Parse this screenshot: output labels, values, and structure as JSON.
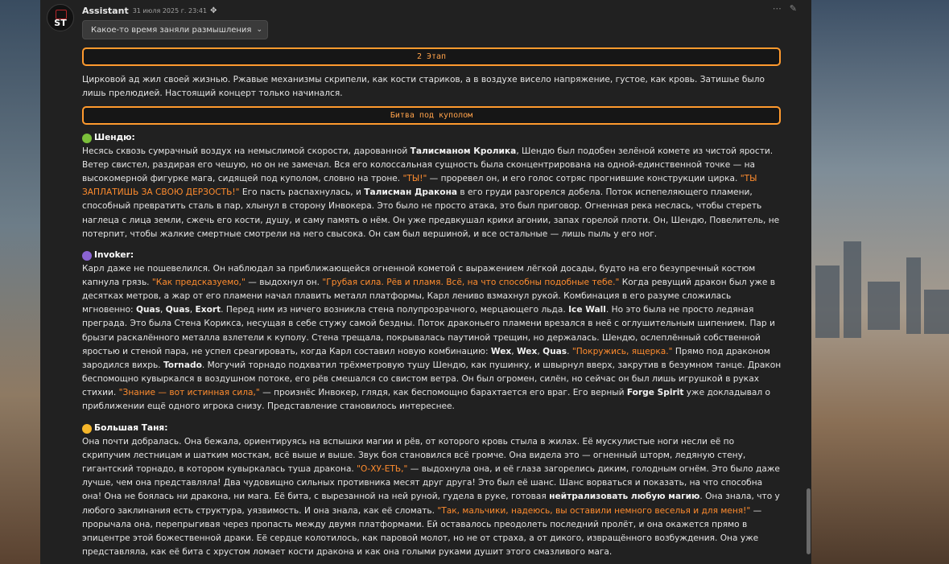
{
  "message": {
    "author": "Assistant",
    "timestamp": "31 июля 2025 г. 23:41",
    "avatar_text": "ST",
    "reasoning_label": "Какое-то время заняли размышления",
    "stage_box": "2 Этап",
    "intro": "Цирковой ад жил своей жизнью. Ржавые механизмы скрипели, как кости стариков, а в воздухе висело напряжение, густое, как кровь. Затишье было лишь прелюдией. Настоящий концерт только начинался.",
    "battle_box": "Битва под куполом"
  },
  "sections": [
    {
      "icon": "dragon-icon",
      "icon_color": "#7bbf3a",
      "name": "Шендю:",
      "segments": [
        [
          "t",
          "Несясь сквозь сумрачный воздух на немыслимой скорости, дарованной "
        ],
        [
          "b",
          "Талисманом Кролика"
        ],
        [
          "t",
          ", Шендю был подобен зелёной комете из чистой ярости. Ветер свистел, раздирая его чешую, но он не замечал. Вся его колоссальная сущность была сконцентрирована на одной-единственной точке — на высокомерной фигурке мага, сидящей под куполом, словно на троне. "
        ],
        [
          "q",
          "\"ТЫ!\""
        ],
        [
          "t",
          " — проревел он, и его голос сотряс прогнившие конструкции цирка. "
        ],
        [
          "q",
          "\"ТЫ ЗАПЛАТИШЬ ЗА СВОЮ ДЕРЗОСТЬ!\""
        ],
        [
          "t",
          " Его пасть распахнулась, и "
        ],
        [
          "b",
          "Талисман Дракона"
        ],
        [
          "t",
          " в его груди разгорелся добела. Поток испепеляющего пламени, способный превратить сталь в пар, хлынул в сторону Инвокера. Это было не просто атака, это был приговор. Огненная река неслась, чтобы стереть наглеца с лица земли, сжечь его кости, душу, и саму память о нём. Он уже предвкушал крики агонии, запах горелой плоти. Он, Шендю, Повелитель, не потерпит, чтобы жалкие смертные смотрели на него свысока. Он сам был вершиной, и все остальные — лишь пыль у его ног."
        ]
      ]
    },
    {
      "icon": "orb-icon",
      "icon_color": "#8a63d2",
      "name": "Invoker:",
      "segments": [
        [
          "t",
          "Карл даже не пошевелился. Он наблюдал за приближающейся огненной кометой с выражением лёгкой досады, будто на его безупречный костюм капнула грязь. "
        ],
        [
          "q",
          "\"Как предсказуемо,\""
        ],
        [
          "t",
          " — выдохнул он. "
        ],
        [
          "q",
          "\"Грубая сила. Рёв и пламя. Всё, на что способны подобные тебе.\""
        ],
        [
          "t",
          " Когда ревущий дракон был уже в десятках метров, а жар от его пламени начал плавить металл платформы, Карл лениво взмахнул рукой. Комбинация в его разуме сложилась мгновенно: "
        ],
        [
          "b",
          "Quas"
        ],
        [
          "t",
          ", "
        ],
        [
          "b",
          "Quas"
        ],
        [
          "t",
          ", "
        ],
        [
          "b",
          "Exort"
        ],
        [
          "t",
          ". Перед ним из ничего возникла стена полупрозрачного, мерцающего льда. "
        ],
        [
          "b",
          "Ice Wall"
        ],
        [
          "t",
          ". Но это была не просто ледяная преграда. Это была Стена Корикса, несущая в себе стужу самой бездны. Поток драконьего пламени врезался в неё с оглушительным шипением. Пар и брызги раскалённого металла взлетели к куполу. Стена трещала, покрывалась паутиной трещин, но держалась. Шендю, ослеплённый собственной яростью и стеной пара, не успел среагировать, когда Карл составил новую комбинацию: "
        ],
        [
          "b",
          "Wex"
        ],
        [
          "t",
          ", "
        ],
        [
          "b",
          "Wex"
        ],
        [
          "t",
          ", "
        ],
        [
          "b",
          "Quas"
        ],
        [
          "t",
          ". "
        ],
        [
          "q",
          "\"Покружись, ящерка.\""
        ],
        [
          "t",
          " Прямо под драконом зародился вихрь. "
        ],
        [
          "b",
          "Tornado"
        ],
        [
          "t",
          ". Могучий торнадо подхватил трёхметровую тушу Шендю, как пушинку, и швырнул вверх, закрутив в безумном танце. Дракон беспомощно кувыркался в воздушном потоке, его рёв смешался со свистом ветра. Он был огромен, силён, но сейчас он был лишь игрушкой в руках стихии. "
        ],
        [
          "q",
          "\"Знание — вот истинная сила,\""
        ],
        [
          "t",
          " — произнёс Инвокер, глядя, как беспомощно барахтается его враг. Его верный "
        ],
        [
          "b",
          "Forge Spirit"
        ],
        [
          "t",
          " уже докладывал о приближении ещё одного игрока снизу. Представление становилось интереснее."
        ]
      ]
    },
    {
      "icon": "flexed-biceps-icon",
      "icon_color": "#f5b62a",
      "name": "Большая Таня:",
      "segments": [
        [
          "t",
          "Она почти добралась. Она бежала, ориентируясь на вспышки магии и рёв, от которого кровь стыла в жилах. Её мускулистые ноги несли её по скрипучим лестницам и шатким мосткам, всё выше и выше. Звук боя становился всё громче. Она видела это — огненный шторм, ледяную стену, гигантский торнадо, в котором кувыркалась туша дракона. "
        ],
        [
          "q",
          "\"О-ХУ-ЕТЬ,\""
        ],
        [
          "t",
          " — выдохнула она, и её глаза загорелись диким, голодным огнём. Это было даже лучше, чем она представляла! Два чудовищно сильных противника месят друг друга! Это был её шанс. Шанс ворваться и показать, на что способна она! Она не боялась ни дракона, ни мага. Её бита, с вырезанной на ней руной, гудела в руке, готовая "
        ],
        [
          "b",
          "нейтрализовать любую магию"
        ],
        [
          "t",
          ". Она знала, что у любого заклинания есть структура, уязвимость. И она знала, как её сломать. "
        ],
        [
          "q",
          "\"Так, мальчики, надеюсь, вы оставили немного веселья и для меня!\""
        ],
        [
          "t",
          " — прорычала она, перепрыгивая через пропасть между двумя платформами. Ей оставалось преодолеть последний пролёт, и она окажется прямо в эпицентре этой божественной драки. Её сердце колотилось, как паровой молот, но не от страха, а от дикого, извращённого возбуждения. Она уже представляла, как её бита с хрустом ломает кости дракона и как она голыми руками душит этого смазливого мага."
        ]
      ]
    }
  ]
}
